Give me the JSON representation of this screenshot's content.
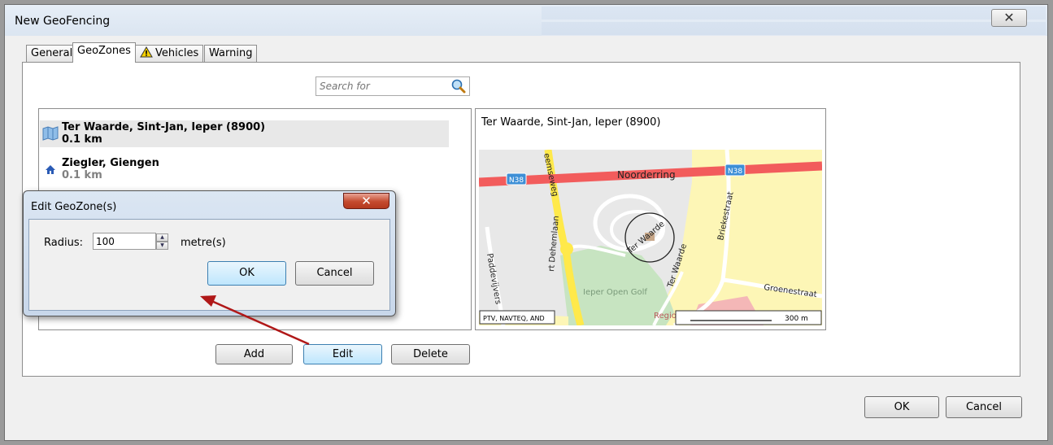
{
  "window": {
    "title": "New GeoFencing",
    "close_glyph": "✕"
  },
  "tabs": [
    {
      "label": "General"
    },
    {
      "label": "GeoZones",
      "active": true
    },
    {
      "label": "Vehicles",
      "icon": "warning-icon"
    },
    {
      "label": "Warning"
    }
  ],
  "search": {
    "placeholder": "Search for",
    "value": ""
  },
  "geozones": [
    {
      "name": "Ter Waarde, Sint-Jan, Ieper (8900)",
      "distance": "0.1 km",
      "selected": true,
      "icon": "map-zone-icon"
    },
    {
      "name": "Ziegler, Giengen",
      "distance": "0.1 km",
      "selected": false,
      "icon": "home-icon"
    }
  ],
  "map_panel": {
    "title": "Ter Waarde, Sint-Jan, Ieper (8900)",
    "labels": {
      "noorderring": "Noorderring",
      "n38_left": "N38",
      "n38_right": "N38",
      "briekestraat": "Briekestraat",
      "groenestraat": "Groenestraat",
      "ter_waarde_road": "Ter Waarde",
      "ter_waarde_circle": "Ter Waarde",
      "golf": "Ieper Open Golf",
      "dehemlaan": "rt Dehemlaan",
      "paddevijver": "Paddevijvers",
      "left_road": "eemseweg",
      "hospital": "Regionaal Ziekenhuis Jan Yperman"
    },
    "copyright": "PTV, NAVTEQ, AND",
    "scale": "300 m"
  },
  "list_buttons": {
    "add": "Add",
    "edit": "Edit",
    "delete": "Delete"
  },
  "dialog": {
    "title": "Edit GeoZone(s)",
    "close_glyph": "✕",
    "radius_label": "Radius:",
    "radius_value": "100",
    "unit": "metre(s)",
    "ok": "OK",
    "cancel": "Cancel"
  },
  "footer": {
    "ok": "OK",
    "cancel": "Cancel"
  },
  "colors": {
    "annotation_arrow": "#b01818",
    "road_red": "#f25c5c",
    "road_yellow": "#ffe94a",
    "map_yellow": "#fdf6b6"
  }
}
